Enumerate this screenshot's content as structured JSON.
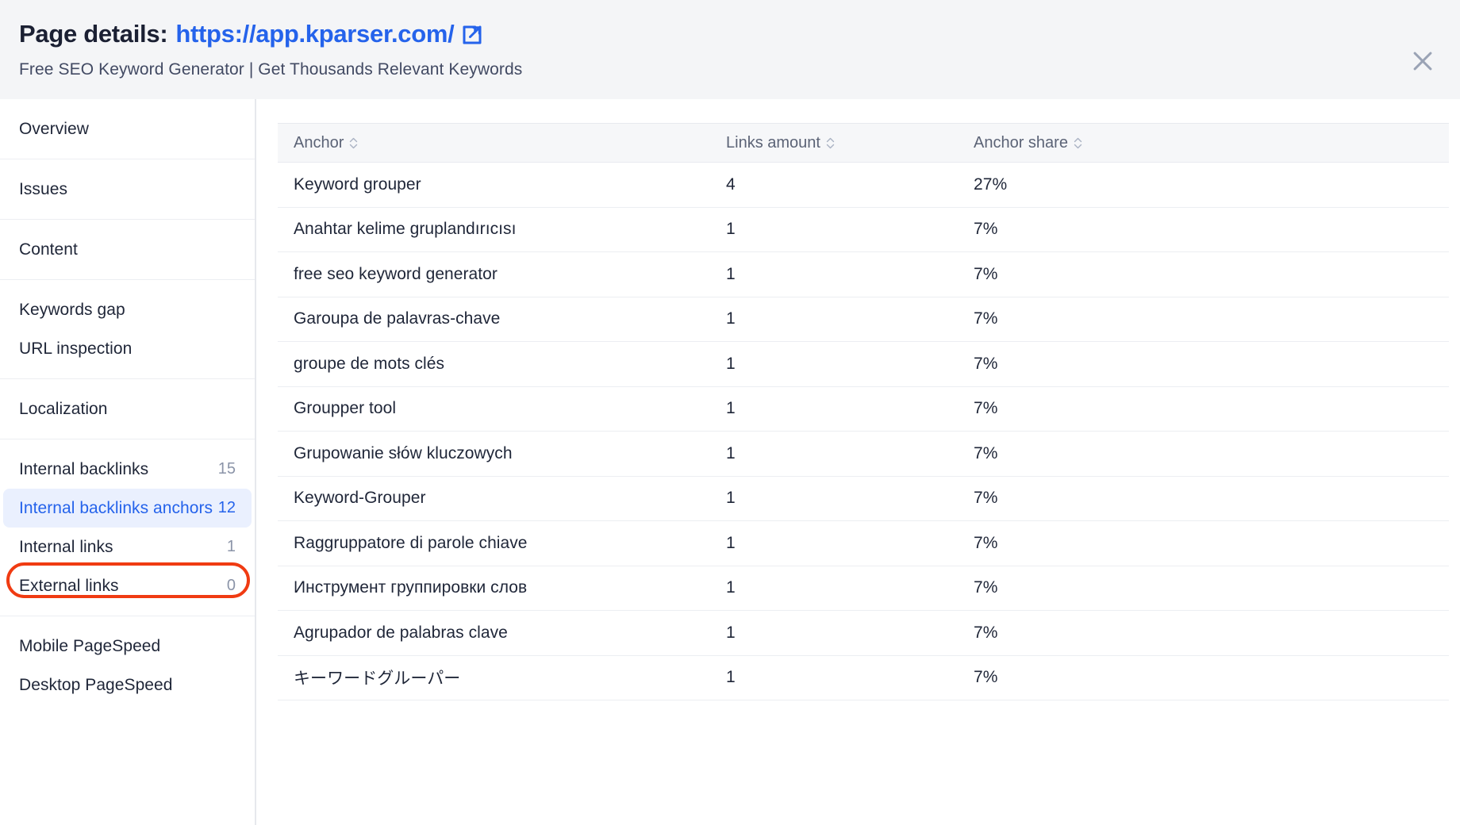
{
  "header": {
    "title_prefix": "Page details:",
    "url": "https://app.kparser.com/",
    "subtitle": "Free SEO Keyword Generator | Get Thousands Relevant Keywords",
    "external_link_icon": "external-link-icon",
    "close_icon": "close-icon"
  },
  "colors": {
    "accent_blue": "#2563eb",
    "annotation_red": "#f03b12",
    "active_bg": "#eaf0fe",
    "header_bg": "#f4f5f7",
    "table_head_bg": "#f6f7f9",
    "text_dark": "#1f2638",
    "text_muted": "#8b94a8"
  },
  "sidebar": {
    "groups": [
      {
        "items": [
          {
            "label": "Overview",
            "count": "",
            "active": false
          }
        ]
      },
      {
        "items": [
          {
            "label": "Issues",
            "count": "",
            "active": false
          }
        ]
      },
      {
        "items": [
          {
            "label": "Content",
            "count": "",
            "active": false
          }
        ]
      },
      {
        "items": [
          {
            "label": "Keywords gap",
            "count": "",
            "active": false
          },
          {
            "label": "URL inspection",
            "count": "",
            "active": false
          }
        ]
      },
      {
        "items": [
          {
            "label": "Localization",
            "count": "",
            "active": false
          }
        ]
      },
      {
        "items": [
          {
            "label": "Internal backlinks",
            "count": "15",
            "active": false
          },
          {
            "label": "Internal backlinks anchors",
            "count": "12",
            "active": true
          },
          {
            "label": "Internal links",
            "count": "1",
            "active": false
          },
          {
            "label": "External links",
            "count": "0",
            "active": false
          }
        ]
      },
      {
        "items": [
          {
            "label": "Mobile PageSpeed",
            "count": "",
            "active": false
          },
          {
            "label": "Desktop PageSpeed",
            "count": "",
            "active": false
          }
        ]
      }
    ]
  },
  "table": {
    "columns": [
      {
        "label": "Anchor",
        "sortable": true
      },
      {
        "label": "Links amount",
        "sortable": true
      },
      {
        "label": "Anchor share",
        "sortable": true
      }
    ],
    "rows": [
      {
        "anchor": "Keyword grouper",
        "links": "4",
        "share": "27%"
      },
      {
        "anchor": "Anahtar kelime gruplandırıcısı",
        "links": "1",
        "share": "7%"
      },
      {
        "anchor": "free seo keyword generator",
        "links": "1",
        "share": "7%"
      },
      {
        "anchor": "Garoupa de palavras-chave",
        "links": "1",
        "share": "7%"
      },
      {
        "anchor": "groupe de mots clés",
        "links": "1",
        "share": "7%"
      },
      {
        "anchor": "Groupper tool",
        "links": "1",
        "share": "7%"
      },
      {
        "anchor": "Grupowanie słów kluczowych",
        "links": "1",
        "share": "7%"
      },
      {
        "anchor": "Keyword-Grouper",
        "links": "1",
        "share": "7%"
      },
      {
        "anchor": "Raggruppatore di parole chiave",
        "links": "1",
        "share": "7%"
      },
      {
        "anchor": "Инструмент группировки слов",
        "links": "1",
        "share": "7%"
      },
      {
        "anchor": "Agrupador de palabras clave",
        "links": "1",
        "share": "7%"
      },
      {
        "anchor": "キーワードグルーパー",
        "links": "1",
        "share": "7%"
      }
    ]
  }
}
